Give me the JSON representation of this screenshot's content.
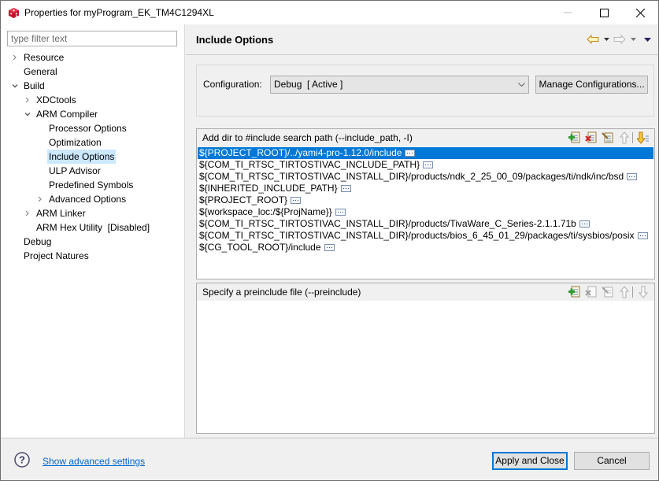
{
  "window": {
    "title": "Properties for myProgram_EK_TM4C1294XL",
    "icon": "ccs-cube-icon",
    "controls": [
      "minimize",
      "maximize",
      "close"
    ]
  },
  "sidebar": {
    "filter_placeholder": "type filter text",
    "filter_value": "",
    "tree": [
      {
        "label": "Resource",
        "level": 0,
        "twisty": "collapsed"
      },
      {
        "label": "General",
        "level": 0,
        "twisty": "none"
      },
      {
        "label": "Build",
        "level": 0,
        "twisty": "expanded"
      },
      {
        "label": "XDCtools",
        "level": 1,
        "twisty": "collapsed"
      },
      {
        "label": "ARM Compiler",
        "level": 1,
        "twisty": "expanded"
      },
      {
        "label": "Processor Options",
        "level": 2,
        "twisty": "none"
      },
      {
        "label": "Optimization",
        "level": 2,
        "twisty": "none"
      },
      {
        "label": "Include Options",
        "level": 2,
        "twisty": "none",
        "selected": true
      },
      {
        "label": "ULP Advisor",
        "level": 2,
        "twisty": "none"
      },
      {
        "label": "Predefined Symbols",
        "level": 2,
        "twisty": "none"
      },
      {
        "label": "Advanced Options",
        "level": 2,
        "twisty": "collapsed"
      },
      {
        "label": "ARM Linker",
        "level": 1,
        "twisty": "collapsed"
      },
      {
        "label": "ARM Hex Utility  [Disabled]",
        "level": 1,
        "twisty": "none"
      },
      {
        "label": "Debug",
        "level": 0,
        "twisty": "none"
      },
      {
        "label": "Project Natures",
        "level": 0,
        "twisty": "none"
      }
    ]
  },
  "main": {
    "page_title": "Include Options",
    "nav": {
      "back_icon": "back-arrow-icon",
      "forward_icon": "forward-arrow-icon",
      "menu_icon": "view-menu-icon"
    },
    "configuration": {
      "label": "Configuration:",
      "selected": "Debug  [ Active ]",
      "manage_button": "Manage Configurations..."
    },
    "include_paths": {
      "title": "Add dir to #include search path (--include_path, -I)",
      "tools": [
        "add-icon",
        "delete-icon",
        "edit-icon",
        "move-up-icon",
        "move-down-icon"
      ],
      "items": [
        "${PROJECT_ROOT}/../yami4-pro-1.12.0/include",
        "${COM_TI_RTSC_TIRTOSTIVAC_INCLUDE_PATH}",
        "${COM_TI_RTSC_TIRTOSTIVAC_INSTALL_DIR}/products/ndk_2_25_00_09/packages/ti/ndk/inc/bsd",
        "${INHERITED_INCLUDE_PATH}",
        "${PROJECT_ROOT}",
        "${workspace_loc:/${ProjName}}",
        "${COM_TI_RTSC_TIRTOSTIVAC_INSTALL_DIR}/products/TivaWare_C_Series-2.1.1.71b",
        "${COM_TI_RTSC_TIRTOSTIVAC_INSTALL_DIR}/products/bios_6_45_01_29/packages/ti/sysbios/posix",
        "${CG_TOOL_ROOT}/include"
      ],
      "selected_index": 0
    },
    "preinclude": {
      "title": "Specify a preinclude file (--preinclude)",
      "items": []
    }
  },
  "footer": {
    "help_icon": "help-icon",
    "advanced_link": "Show advanced settings",
    "apply_button": "Apply and Close",
    "cancel_button": "Cancel"
  },
  "colors": {
    "selection_blue": "#0078d7",
    "tree_selection": "#cce8ff",
    "link": "#0066cc"
  }
}
